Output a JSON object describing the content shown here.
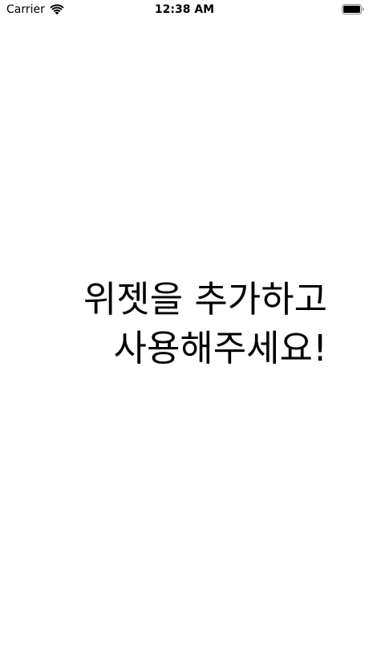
{
  "status_bar": {
    "carrier": "Carrier",
    "time": "12:38 AM",
    "icons": [
      "wifi-icon",
      "battery-icon"
    ]
  },
  "main": {
    "message_line_1": "위젯을 추가하고",
    "message_line_2": "사용해주세요!"
  },
  "colors": {
    "background": "#ffffff",
    "text": "#000000"
  }
}
